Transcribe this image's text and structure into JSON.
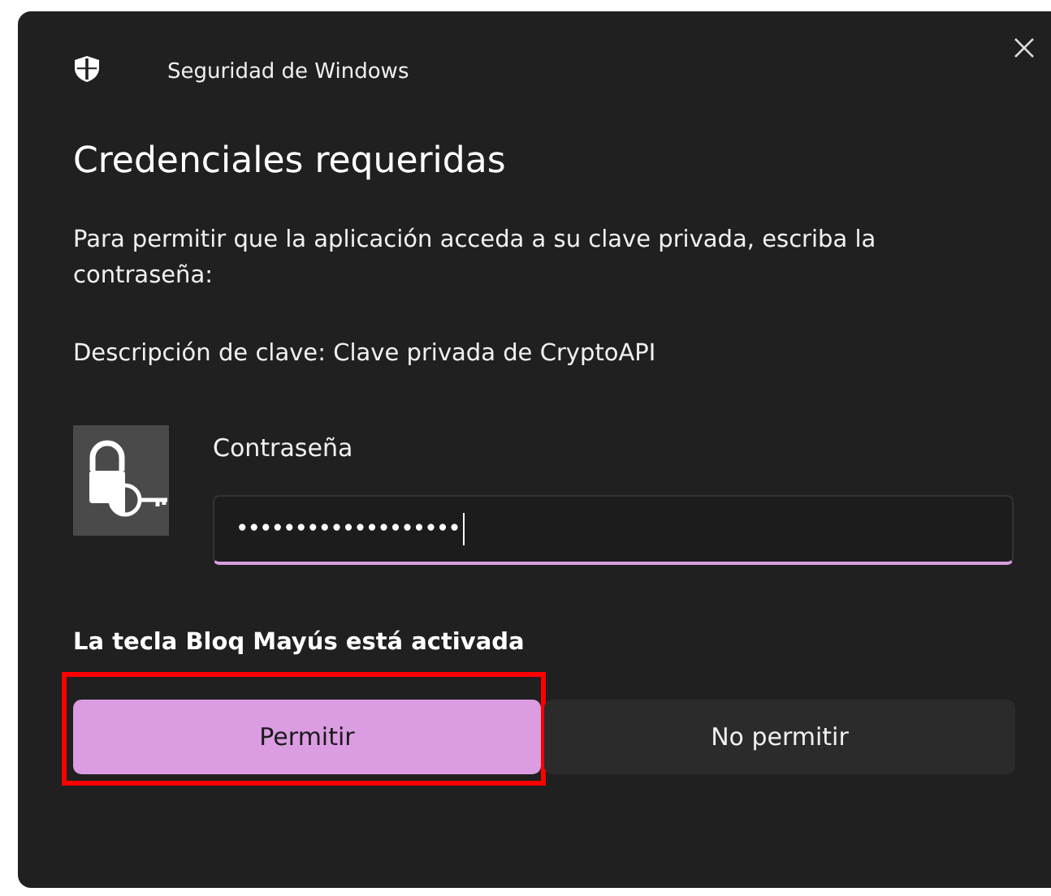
{
  "window": {
    "title": "Seguridad de Windows"
  },
  "heading": "Credenciales requeridas",
  "message": "Para permitir que la aplicación acceda a su clave privada, escriba la contraseña:",
  "key_description": "Descripción de clave: Clave privada de CryptoAPI",
  "password": {
    "label": "Contraseña",
    "value": "•••••••••••••••••••",
    "focused": true
  },
  "warning": "La tecla Bloq Mayús está activada",
  "buttons": [
    {
      "label": "Permitir",
      "kind": "primary",
      "highlighted": true
    },
    {
      "label": "No permitir",
      "kind": "secondary",
      "highlighted": false
    }
  ]
}
